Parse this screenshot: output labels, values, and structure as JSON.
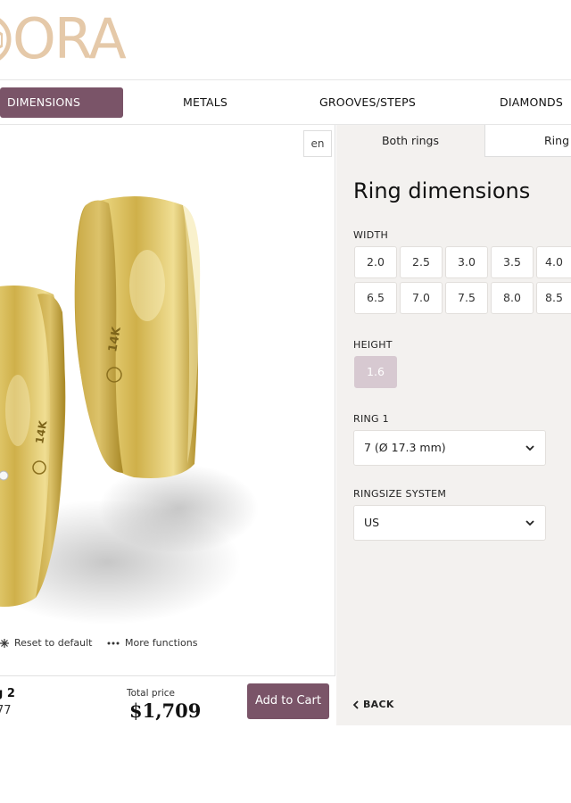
{
  "logo": {
    "text": "ORA",
    "color": "#e5c9a9"
  },
  "nav": {
    "items": [
      {
        "label": "DIMENSIONS",
        "active": true
      },
      {
        "label": "METALS",
        "active": false
      },
      {
        "label": "GROOVES/STEPS",
        "active": false
      },
      {
        "label": "DIAMONDS",
        "active": false
      }
    ],
    "accent_color": "#7a5468"
  },
  "viewer": {
    "language": "en",
    "ring_stamp_1": "14K",
    "ring_stamp_2": "14K",
    "tools": {
      "reset_label": "Reset to default",
      "more_label": "More functions"
    }
  },
  "summary": {
    "ring_name": "g 2",
    "ring_sub": "77",
    "total_label": "Total price",
    "total_price": "$1,709",
    "cart_label": "Add to Cart"
  },
  "config": {
    "tabs": [
      {
        "label": "Both rings",
        "active": true
      },
      {
        "label": "Ring",
        "active": false
      }
    ],
    "title": "Ring dimensions",
    "width_label": "WIDTH",
    "width_options": [
      "2.0",
      "2.5",
      "3.0",
      "3.5",
      "4.0",
      "6.5",
      "7.0",
      "7.5",
      "8.0",
      "8.5"
    ],
    "height_label": "HEIGHT",
    "height_options": [
      {
        "value": "1.6",
        "selected": true
      }
    ],
    "ring1_label": "RING 1",
    "ring1_value": "7 (Ø 17.3 mm)",
    "ringsize_label": "RINGSIZE SYSTEM",
    "ringsize_value": "US",
    "back_label": "BACK"
  }
}
